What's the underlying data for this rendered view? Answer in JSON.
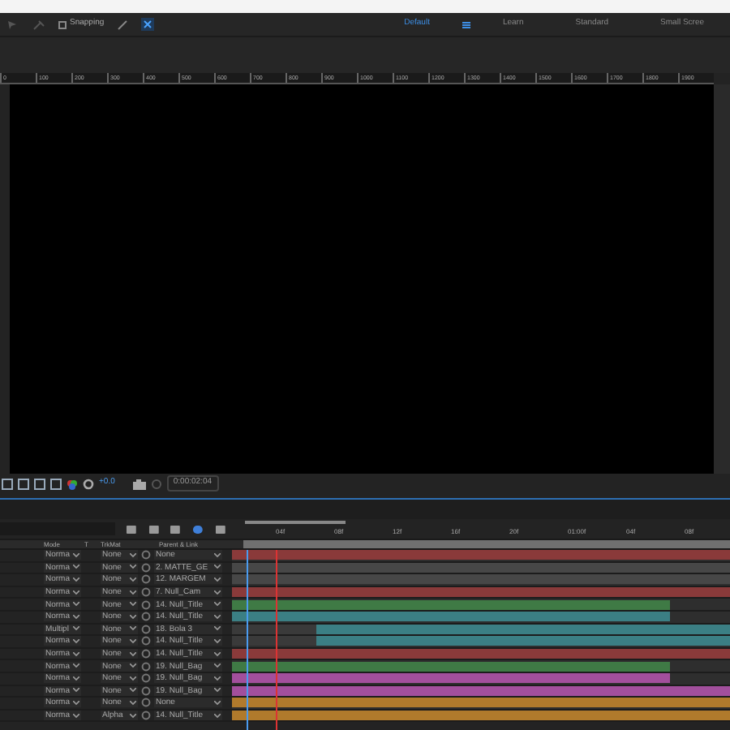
{
  "toolbar": {
    "snapping": {
      "label": "Snapping",
      "checked": false
    },
    "workspaces": [
      {
        "label": "Default",
        "selected": true
      },
      {
        "label": "Learn",
        "selected": false
      },
      {
        "label": "Standard",
        "selected": false
      },
      {
        "label": "Small Scree",
        "selected": false
      }
    ]
  },
  "ruler": [
    "0",
    "100",
    "200",
    "300",
    "400",
    "500",
    "600",
    "700",
    "800",
    "900",
    "1000",
    "1100",
    "1200",
    "1300",
    "1400",
    "1500",
    "1600",
    "1700",
    "1800",
    "1900"
  ],
  "viewer_toolbar": {
    "exposure": "+0.0",
    "timecode": "0:00:02:04"
  },
  "timeline": {
    "columns": [
      "Mode",
      "T",
      "TrkMat",
      "Parent & Link"
    ],
    "ticks": [
      "04f",
      "08f",
      "12f",
      "16f",
      "20f",
      "01:00f",
      "04f",
      "08f"
    ],
    "layers": [
      {
        "mode": "Norma",
        "trkmat": "None",
        "parent": "None",
        "color": "#8a3a3a",
        "kind": "full"
      },
      {
        "mode": "Norma",
        "trkmat": "None",
        "parent": "2. MATTE_GE",
        "color": "#474747",
        "kind": "full"
      },
      {
        "mode": "Norma",
        "trkmat": "None",
        "parent": "12. MARGEM",
        "color": "#474747",
        "kind": "full"
      },
      {
        "mode": "Norma",
        "trkmat": "None",
        "parent": "7. Null_Cam",
        "color": "#8a3a3a",
        "kind": "full"
      },
      {
        "mode": "Norma",
        "trkmat": "None",
        "parent": "14. Null_Title",
        "color": "#3f7a45",
        "kind": "short"
      },
      {
        "mode": "Norma",
        "trkmat": "None",
        "parent": "14. Null_Title",
        "color": "#3b7f84",
        "kind": "short"
      },
      {
        "mode": "Multipl",
        "trkmat": "None",
        "parent": "18. Bola 3",
        "color": "#3b7f84",
        "kind": "offset"
      },
      {
        "mode": "Norma",
        "trkmat": "None",
        "parent": "14. Null_Title",
        "color": "#3b7f84",
        "kind": "offset"
      },
      {
        "mode": "Norma",
        "trkmat": "None",
        "parent": "14. Null_Title",
        "color": "#8a3a3a",
        "kind": "full"
      },
      {
        "mode": "Norma",
        "trkmat": "None",
        "parent": "19. Null_Bag",
        "color": "#3f7a45",
        "kind": "short"
      },
      {
        "mode": "Norma",
        "trkmat": "None",
        "parent": "19. Null_Bag",
        "color": "#a24f9c",
        "kind": "short"
      },
      {
        "mode": "Norma",
        "trkmat": "None",
        "parent": "19. Null_Bag",
        "color": "#a24f9c",
        "kind": "full"
      },
      {
        "mode": "Norma",
        "trkmat": "None",
        "parent": "None",
        "color": "#b07a2c",
        "kind": "full"
      },
      {
        "mode": "Norma",
        "trkmat": "Alpha",
        "parent": "14. Null_Title",
        "color": "#b07a2c",
        "kind": "full"
      }
    ]
  }
}
